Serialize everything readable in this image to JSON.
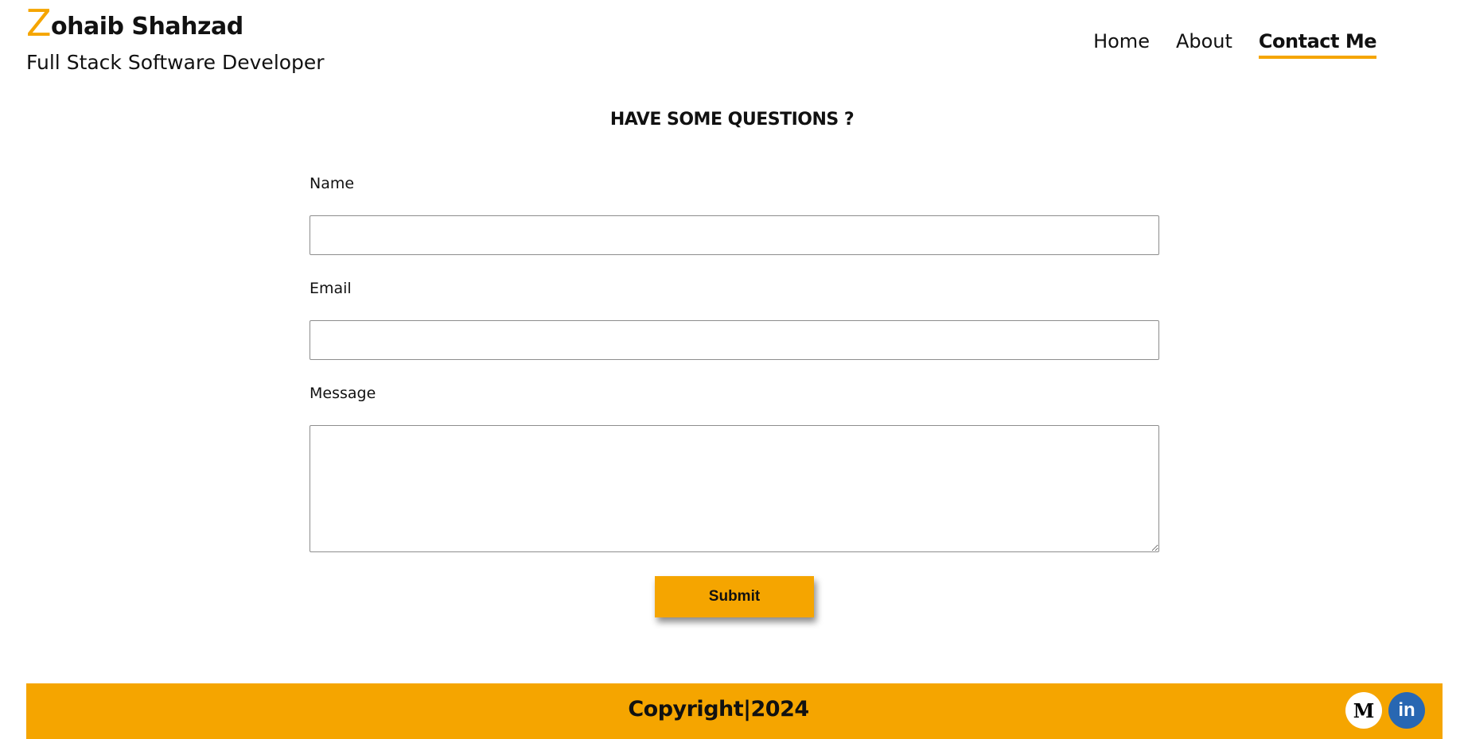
{
  "brand": {
    "initial": "Z",
    "name_rest": "ohaib Shahzad",
    "tagline": "Full Stack Software Developer"
  },
  "nav": {
    "items": [
      {
        "label": "Home",
        "active": false
      },
      {
        "label": "About",
        "active": false
      },
      {
        "label": "Contact Me",
        "active": true
      }
    ]
  },
  "form": {
    "title": "HAVE SOME QUESTIONS ?",
    "name_label": "Name",
    "name_value": "",
    "email_label": "Email",
    "email_value": "",
    "message_label": "Message",
    "message_value": "",
    "submit_label": "Submit"
  },
  "footer": {
    "copyright": "Copyright|2024",
    "socials": [
      {
        "icon": "medium-icon",
        "glyph": "M"
      },
      {
        "icon": "linkedin-icon",
        "glyph": "in"
      }
    ]
  },
  "colors": {
    "accent": "#f5a500",
    "linkedin": "#2867b2",
    "text": "#111111"
  }
}
